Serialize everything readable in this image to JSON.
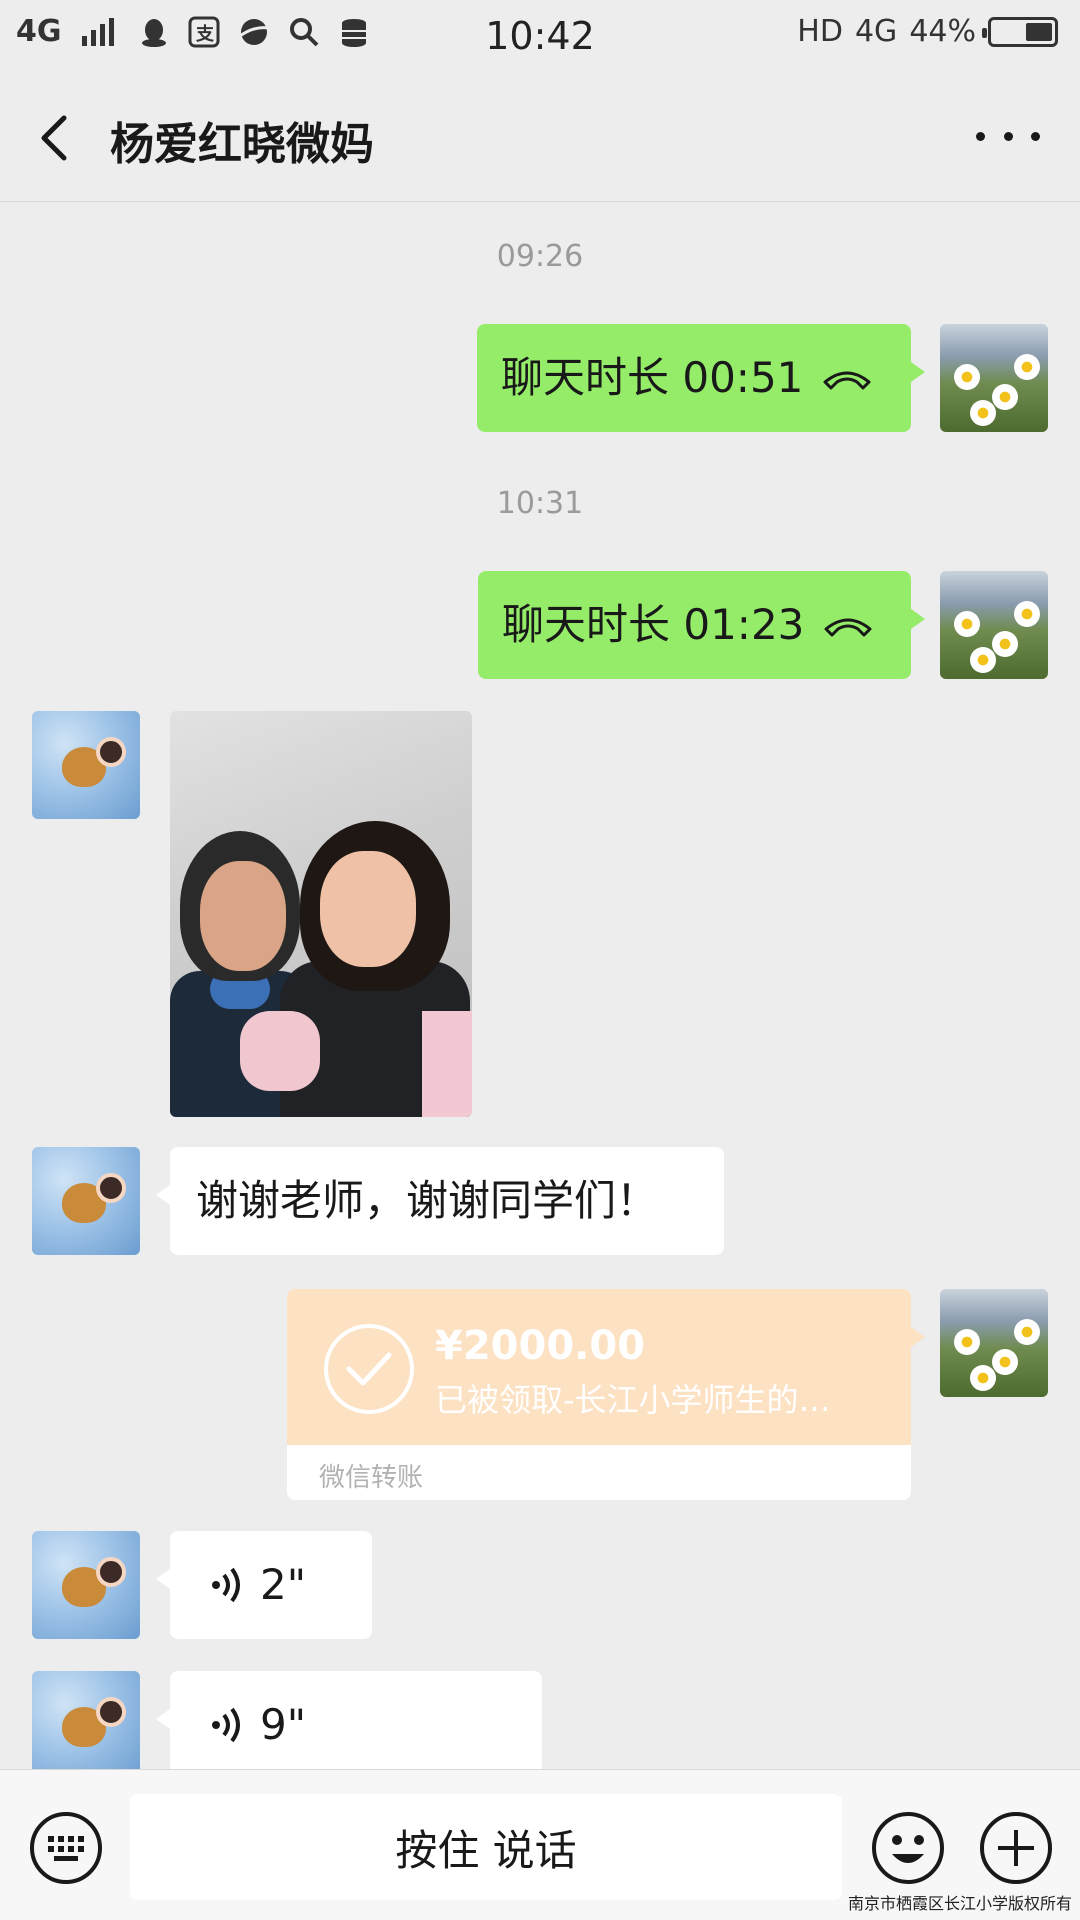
{
  "statusbar": {
    "network": "4G",
    "time": "10:42",
    "hd": "HD",
    "net2": "4G",
    "battery": "44%",
    "battery_level": 0.44
  },
  "header": {
    "title": "杨爱红晓微妈"
  },
  "messages": {
    "ts1": "09:26",
    "call1_text": "聊天时长 00:51",
    "ts2": "10:31",
    "call2_text": "聊天时长 01:23",
    "thanks_text": "谢谢老师，谢谢同学们！",
    "transfer_amount": "¥2000.00",
    "transfer_desc": "已被领取-长江小学师生的…",
    "transfer_footer": "微信转账",
    "voice1": "2\"",
    "voice2": "9\""
  },
  "input": {
    "talk_label": "按住 说话"
  },
  "watermark": "南京市栖霞区长江小学版权所有",
  "colors": {
    "bubble_green": "#95ec69",
    "transfer_orange": "#fde1c3",
    "background": "#ededed"
  }
}
